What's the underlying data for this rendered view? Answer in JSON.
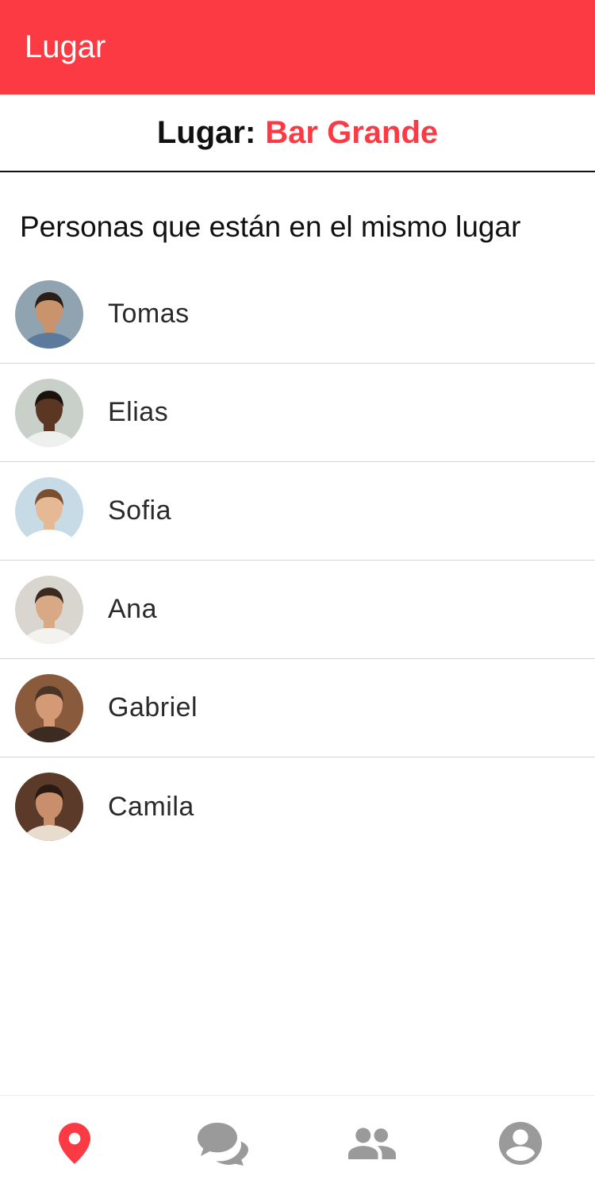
{
  "app_bar": {
    "title": "Lugar"
  },
  "place": {
    "label": "Lugar:",
    "value": "Bar Grande"
  },
  "section": {
    "title": "Personas que están en el mismo lugar"
  },
  "people": [
    {
      "name": "Tomas",
      "avatar": {
        "bg": "#8fa4b0",
        "skin": "#c9936b",
        "hair": "#2a1e17",
        "shirt": "#5b7a9c"
      }
    },
    {
      "name": "Elias",
      "avatar": {
        "bg": "#c9cfc9",
        "skin": "#5a3623",
        "hair": "#1a120d",
        "shirt": "#eef0ee"
      }
    },
    {
      "name": "Sofia",
      "avatar": {
        "bg": "#c7dbe6",
        "skin": "#e6b995",
        "hair": "#7a4e2e",
        "shirt": "#ffffff"
      }
    },
    {
      "name": "Ana",
      "avatar": {
        "bg": "#d9d6d0",
        "skin": "#d9a884",
        "hair": "#3a2a20",
        "shirt": "#f4f2ee"
      }
    },
    {
      "name": "Gabriel",
      "avatar": {
        "bg": "#8a5a3c",
        "skin": "#d49a76",
        "hair": "#4a3426",
        "shirt": "#3b2b22"
      }
    },
    {
      "name": "Camila",
      "avatar": {
        "bg": "#5b3a2a",
        "skin": "#c98e6c",
        "hair": "#2a1a12",
        "shirt": "#e8dccf"
      }
    }
  ],
  "nav": {
    "items": [
      {
        "icon": "location-pin-icon",
        "active": true
      },
      {
        "icon": "chat-bubbles-icon",
        "active": false
      },
      {
        "icon": "people-icon",
        "active": false
      },
      {
        "icon": "account-circle-icon",
        "active": false
      }
    ],
    "active_color": "#fc3a43",
    "inactive_color": "#9a9a9a"
  },
  "colors": {
    "accent": "#fc3a43"
  }
}
